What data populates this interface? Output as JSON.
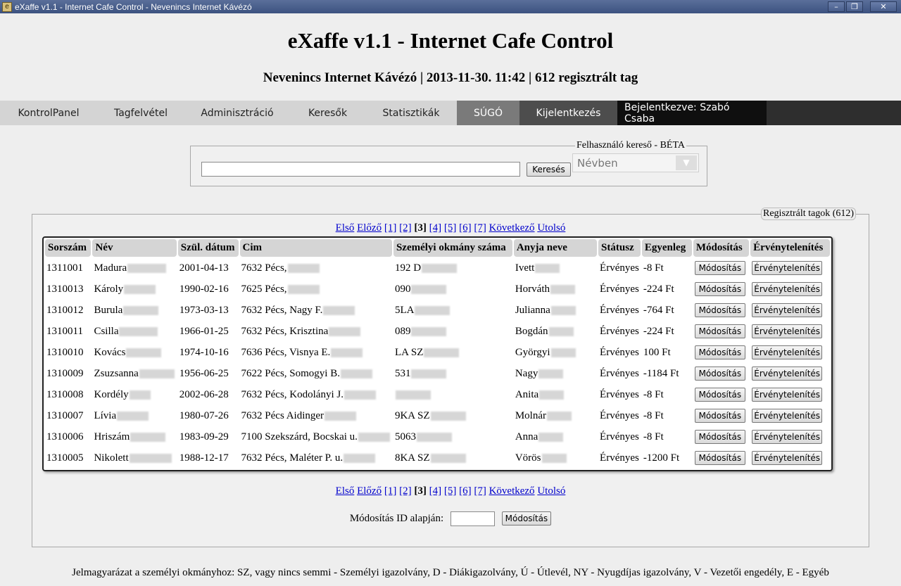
{
  "window": {
    "title": "eXaffe v1.1 - Internet Cafe Control - Nevenincs Internet Kávézó",
    "icon": "app-icon"
  },
  "header": {
    "title": "eXaffe v1.1 - Internet Cafe Control",
    "subtitle": "Nevenincs Internet Kávézó | 2013-11-30. 11:42 | 612 regisztrált tag"
  },
  "nav": {
    "items": [
      {
        "label": "KontrolPanel"
      },
      {
        "label": "Tagfelvétel"
      },
      {
        "label": "Adminisztráció"
      },
      {
        "label": "Keresők"
      },
      {
        "label": "Statisztikák"
      },
      {
        "label": "SÚGÓ"
      },
      {
        "label": "Kijelentkezés"
      }
    ],
    "logged_in": "Bejelentkezve: Szabó Csaba"
  },
  "search": {
    "legend": "Felhasználó kereső - BÉTA",
    "input_value": "",
    "button": "Keresés",
    "select_value": "Névben"
  },
  "members": {
    "legend": "Regisztrált tagok (612)",
    "pager": {
      "first": "Első",
      "prev": "Előző",
      "pages": [
        "[1]",
        "[2]",
        "[3]",
        "[4]",
        "[5]",
        "[6]",
        "[7]"
      ],
      "next": "Következő",
      "last": "Utolsó"
    },
    "columns": [
      "Sorszám",
      "Név",
      "Szül. dátum",
      "Cim",
      "Személyi okmány száma",
      "Anyja neve",
      "Státusz",
      "Egyenleg",
      "Módosítás",
      "Érvénytelenítés"
    ],
    "rows": [
      {
        "id": "1311001",
        "name": "Madura",
        "birth": "2001-04-13",
        "addr": "7632 Pécs,",
        "doc": "192 D",
        "mother": "Ivett",
        "status": "Érvényes",
        "balance": "-8 Ft"
      },
      {
        "id": "1310013",
        "name": "Károly",
        "birth": "1990-02-16",
        "addr": "7625 Pécs,",
        "doc": "090",
        "mother": "Horváth",
        "status": "Érvényes",
        "balance": "-224 Ft"
      },
      {
        "id": "1310012",
        "name": "Burula",
        "birth": "1973-03-13",
        "addr": "7632 Pécs, Nagy F.",
        "doc": "5LA",
        "mother": "Julianna",
        "status": "Érvényes",
        "balance": "-764 Ft"
      },
      {
        "id": "1310011",
        "name": "Csilla",
        "birth": "1966-01-25",
        "addr": "7632 Pécs, Krisztina",
        "doc": "089",
        "mother": "Bogdán",
        "status": "Érvényes",
        "balance": "-224 Ft"
      },
      {
        "id": "1310010",
        "name": "Kovács",
        "birth": "1974-10-16",
        "addr": "7636 Pécs, Visnya E.",
        "doc": "LA SZ",
        "mother": "Györgyi",
        "status": "Érvényes",
        "balance": "100 Ft"
      },
      {
        "id": "1310009",
        "name": "Zsuzsanna",
        "birth": "1956-06-25",
        "addr": "7622 Pécs, Somogyi B.",
        "doc": "531",
        "mother": "Nagy",
        "status": "Érvényes",
        "balance": "-1184 Ft"
      },
      {
        "id": "1310008",
        "name": "Kordély",
        "birth": "2002-06-28",
        "addr": "7632 Pécs, Kodolányi J.",
        "doc": "",
        "mother": "Anita",
        "status": "Érvényes",
        "balance": "-8 Ft"
      },
      {
        "id": "1310007",
        "name": "Lívia",
        "birth": "1980-07-26",
        "addr": "7632 Pécs Aidinger",
        "doc": "9KA SZ",
        "mother": "Molnár",
        "status": "Érvényes",
        "balance": "-8 Ft"
      },
      {
        "id": "1310006",
        "name": "Hriszám",
        "birth": "1983-09-29",
        "addr": "7100 Szekszárd, Bocskai u.",
        "doc": "5063",
        "mother": "Anna",
        "status": "Érvényes",
        "balance": "-8 Ft"
      },
      {
        "id": "1310005",
        "name": "Nikolett",
        "birth": "1988-12-17",
        "addr": "7632 Pécs, Maléter P. u.",
        "doc": "8KA SZ",
        "mother": "Vörös",
        "status": "Érvényes",
        "balance": "-1200 Ft"
      }
    ],
    "modify_label": "Módosítás",
    "invalidate_label": "Érvénytelenítés",
    "modify_by_id_label": "Módosítás ID alapján:",
    "modify_by_id_button": "Módosítás",
    "modify_by_id_value": ""
  },
  "footer": {
    "note": "Jelmagyarázat a személyi okmányhoz: SZ, vagy nincs semmi - Személyi igazolvány, D - Diákigazolvány, Ú - Útlevél, NY - Nyugdíjas igazolvány, V - Vezetői engedély, E - Egyéb"
  }
}
